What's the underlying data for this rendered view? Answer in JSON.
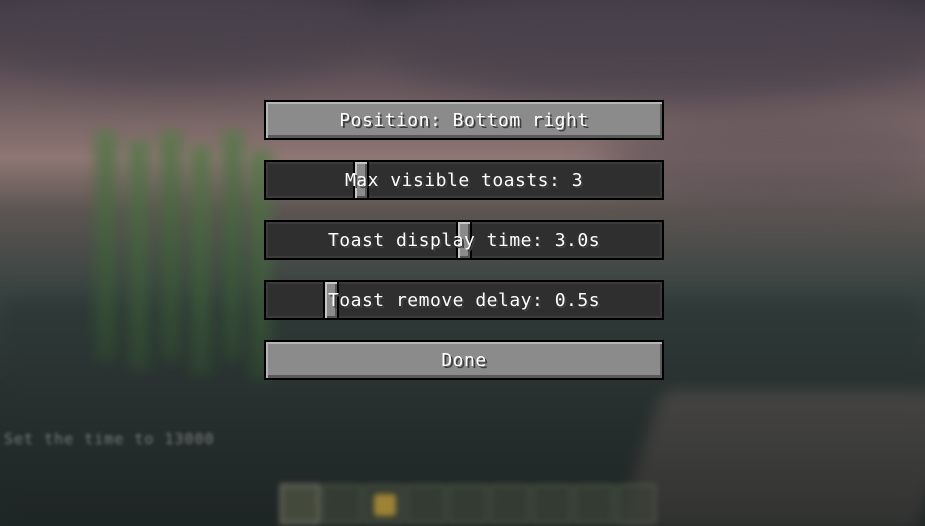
{
  "background": {
    "chat_line": "Set the time to 13000"
  },
  "toast_settings": {
    "position_button": "Position: Bottom right",
    "max_visible_slider": {
      "label": "Max visible toasts: 3",
      "value": 3,
      "level": 0.23
    },
    "display_time_slider": {
      "label": "Toast display time: 3.0s",
      "value": "3.0s",
      "level": 0.5
    },
    "remove_delay_slider": {
      "label": "Toast remove delay: 0.5s",
      "value": "0.5s",
      "level": 0.15
    },
    "done_button": "Done"
  },
  "colors": {
    "button_face": "#8b8b8b",
    "slider_track": "#2f2f2f",
    "text": "#ffffff"
  }
}
